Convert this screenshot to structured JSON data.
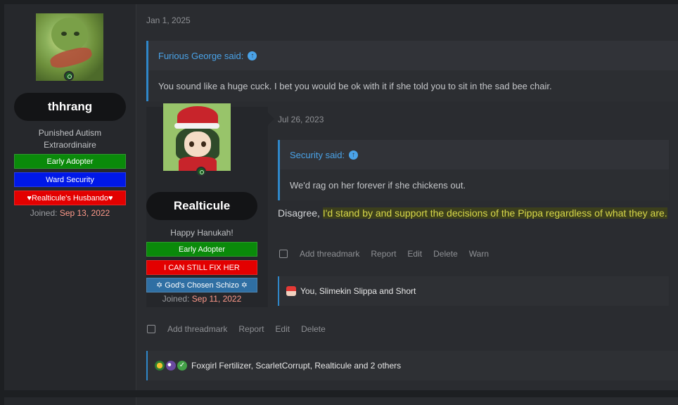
{
  "outer_post": {
    "date": "Jan 1, 2025",
    "user": {
      "name": "thhrang",
      "title_line1": "Punished Autism",
      "title_line2": "Extraordinaire",
      "banners": [
        "Early Adopter",
        "Ward Security",
        "♥Realticule's Husbando♥"
      ],
      "joined_label": "Joined:",
      "joined_date": "Sep 13, 2022"
    },
    "quote": {
      "author": "Furious George said:",
      "text": "You sound like a huge cuck. I bet you would be ok with it if she told you to sit in the sad bee chair."
    },
    "actions": [
      "Add threadmark",
      "Report",
      "Edit",
      "Delete"
    ],
    "reactions_text": "Foxgirl Fertilizer, ScarletCorrupt, Realticule and 2 others"
  },
  "inner_post": {
    "date": "Jul 26, 2023",
    "user": {
      "name": "Realticule",
      "title": "Happy Hanukah!",
      "banners": [
        "Early Adopter",
        "I CAN STILL FIX HER",
        "✡ God's Chosen Schizo ✡"
      ],
      "joined_label": "Joined:",
      "joined_date": "Sep 11, 2022"
    },
    "quote": {
      "author": "Security said:",
      "text": "We'd rag on her forever if she chickens out."
    },
    "message_plain": "Disagree, ",
    "message_highlight": "I'd stand by and support the decisions of the Pippa regardless of what they are.",
    "actions": [
      "Add threadmark",
      "Report",
      "Edit",
      "Delete",
      "Warn"
    ],
    "reactions_text": "You, Slimekin Slippa and Short"
  },
  "icons": {
    "quote_arrow": "↑",
    "check": "✓"
  },
  "colors": {
    "accent_blue": "#2f87c9",
    "quote_link": "#4aa3e8",
    "highlight_text": "#d8d84a",
    "banner_green": "#0a8a0a",
    "banner_blue": "#0018e8",
    "banner_red": "#e30000",
    "banner_steel": "#2f6fa3",
    "joined_date": "#ff9a8a"
  }
}
